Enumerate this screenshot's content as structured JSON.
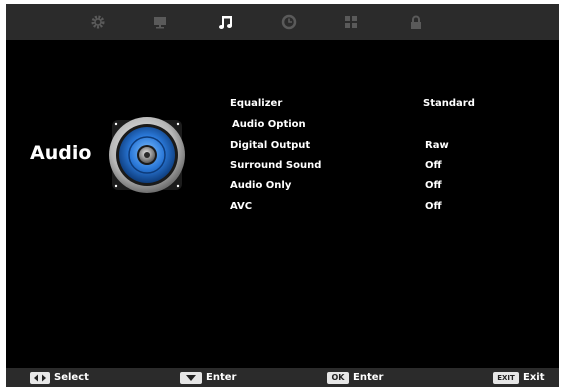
{
  "tabs": [
    {
      "icon": "gear-icon",
      "color": "#5a5a5a",
      "active": false
    },
    {
      "icon": "monitor-icon",
      "color": "#5a5a5a",
      "active": false
    },
    {
      "icon": "music-note-icon",
      "color": "#ffffff",
      "active": true
    },
    {
      "icon": "clock-icon",
      "color": "#5a5a5a",
      "active": false
    },
    {
      "icon": "grid-icon",
      "color": "#5a5a5a",
      "active": false
    },
    {
      "icon": "lock-icon",
      "color": "#5a5a5a",
      "active": false
    }
  ],
  "page": {
    "title": "Audio",
    "icon": "speaker-icon"
  },
  "menu": [
    {
      "label": "Equalizer",
      "value": "Standard"
    },
    {
      "label": "Audio Option",
      "value": ""
    },
    {
      "label": "Digital Output",
      "value": "Raw"
    },
    {
      "label": "Surround Sound",
      "value": "Off"
    },
    {
      "label": "Audio Only",
      "value": "Off"
    },
    {
      "label": "AVC",
      "value": "Off"
    }
  ],
  "footer": {
    "select_label": "Select",
    "enter_label": "Enter",
    "ok_key": "OK",
    "ok_label": "Enter",
    "exit_key": "EXIT",
    "exit_label": "Exit"
  },
  "colors": {
    "background": "#000000",
    "bar": "#2b2b2b",
    "text": "#ffffff",
    "speaker_accent": "#2a78d8"
  }
}
